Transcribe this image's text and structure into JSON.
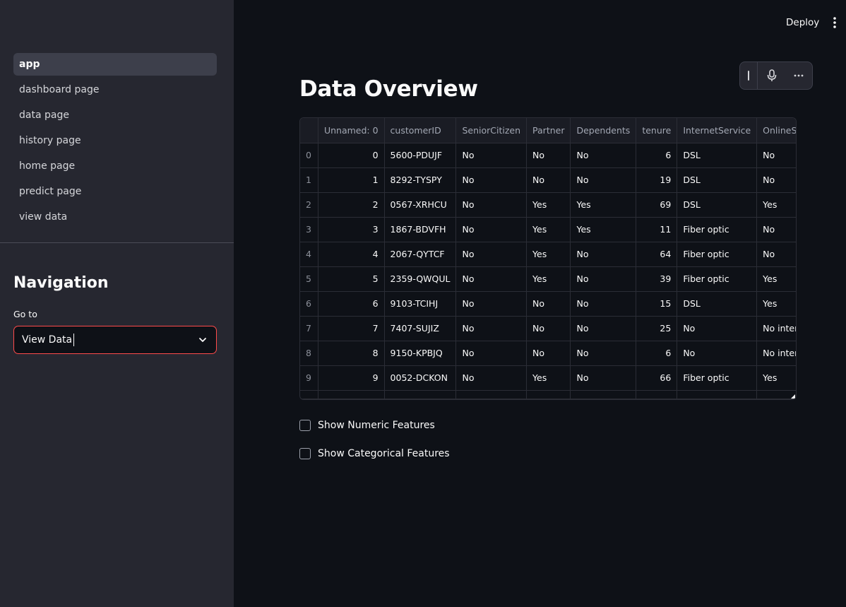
{
  "header": {
    "deploy_label": "Deploy"
  },
  "icons": {
    "menu": "kebab-vertical-icon",
    "mic": "microphone-icon",
    "more": "more-horizontal-icon",
    "chevron": "chevron-down-icon"
  },
  "colors": {
    "accent": "#ff4b4b",
    "sidebar_bg": "#262730",
    "main_bg": "#0e1117"
  },
  "sidebar": {
    "pages": [
      "app",
      "dashboard page",
      "data page",
      "history page",
      "home page",
      "predict page",
      "view data"
    ],
    "active_page": "app",
    "heading": "Navigation",
    "select": {
      "label": "Go to",
      "value": "View Data"
    }
  },
  "main": {
    "title": "Data Overview",
    "table": {
      "columns": [
        "",
        "Unnamed: 0",
        "customerID",
        "SeniorCitizen",
        "Partner",
        "Dependents",
        "tenure",
        "InternetService",
        "OnlineSecurity"
      ],
      "rows": [
        [
          "0",
          "0",
          "5600-PDUJF",
          "No",
          "No",
          "No",
          "6",
          "DSL",
          "No"
        ],
        [
          "1",
          "1",
          "8292-TYSPY",
          "No",
          "No",
          "No",
          "19",
          "DSL",
          "No"
        ],
        [
          "2",
          "2",
          "0567-XRHCU",
          "No",
          "Yes",
          "Yes",
          "69",
          "DSL",
          "Yes"
        ],
        [
          "3",
          "3",
          "1867-BDVFH",
          "No",
          "Yes",
          "Yes",
          "11",
          "Fiber optic",
          "No"
        ],
        [
          "4",
          "4",
          "2067-QYTCF",
          "No",
          "Yes",
          "No",
          "64",
          "Fiber optic",
          "No"
        ],
        [
          "5",
          "5",
          "2359-QWQUL",
          "No",
          "Yes",
          "No",
          "39",
          "Fiber optic",
          "Yes"
        ],
        [
          "6",
          "6",
          "9103-TCIHJ",
          "No",
          "No",
          "No",
          "15",
          "DSL",
          "Yes"
        ],
        [
          "7",
          "7",
          "7407-SUJIZ",
          "No",
          "No",
          "No",
          "25",
          "No",
          "No internet service"
        ],
        [
          "8",
          "8",
          "9150-KPBJQ",
          "No",
          "No",
          "No",
          "6",
          "No",
          "No internet service"
        ],
        [
          "9",
          "9",
          "0052-DCKON",
          "No",
          "Yes",
          "No",
          "66",
          "Fiber optic",
          "Yes"
        ]
      ]
    },
    "checkboxes": [
      {
        "label": "Show Numeric Features",
        "checked": false
      },
      {
        "label": "Show Categorical Features",
        "checked": false
      }
    ]
  }
}
